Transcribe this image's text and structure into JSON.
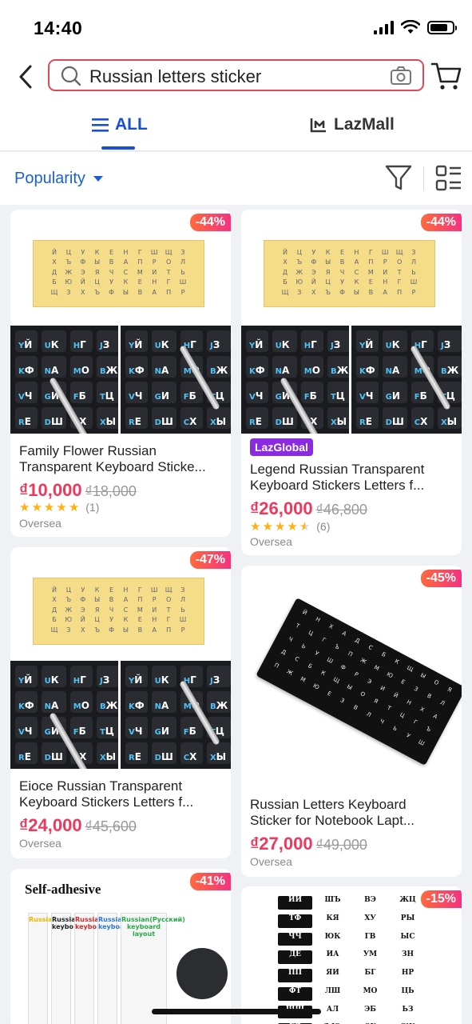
{
  "status_bar": {
    "time": "14:40"
  },
  "search": {
    "query": "Russian letters sticker"
  },
  "tabs": {
    "all_label": "ALL",
    "lazmall_label": "LazMall"
  },
  "sort": {
    "label": "Popularity"
  },
  "products": [
    {
      "discount": "-44%",
      "title_line1": "Family Flower Russian",
      "title_line2": "Transparent Keyboard Sticke...",
      "price": "₫10,000",
      "old_price": "₫18,000",
      "rating": 5,
      "reviews": "(1)",
      "origin": "Oversea"
    },
    {
      "discount": "-44%",
      "badge": "LazGlobal",
      "title_line1": "Legend Russian Transparent",
      "title_line2": "Keyboard Stickers Letters f...",
      "price": "₫26,000",
      "old_price": "₫46,800",
      "rating": 4.5,
      "reviews": "(6)",
      "origin": "Oversea"
    },
    {
      "discount": "-47%",
      "title_line1": "Eioce Russian Transparent",
      "title_line2": "Keyboard Stickers Letters f...",
      "price": "₫24,000",
      "old_price": "₫45,600",
      "origin": "Oversea"
    },
    {
      "discount": "-45%",
      "title_line1": "Russian Letters Keyboard",
      "title_line2": "Sticker for Notebook Lapt...",
      "price": "₫27,000",
      "old_price": "₫49,000",
      "origin": "Oversea"
    },
    {
      "discount": "-41%",
      "image_caption": "Self-adhesive",
      "strip_labels": [
        "Russia",
        "Russia keybo",
        "Russia keybo",
        "Russia keyboa",
        "Russian(Русский) keyboard layout"
      ]
    },
    {
      "discount": "-15%"
    }
  ],
  "icons": [
    "back-icon",
    "search-icon",
    "camera-icon",
    "cart-icon",
    "menu-icon",
    "lazmall-icon",
    "filter-icon",
    "view-toggle-icon"
  ],
  "colors": {
    "accent": "#1a4fd1",
    "price": "#f0385d",
    "search_border": "#e04a58",
    "star": "#ffb20f",
    "lazglobal": "#8a2be2"
  }
}
